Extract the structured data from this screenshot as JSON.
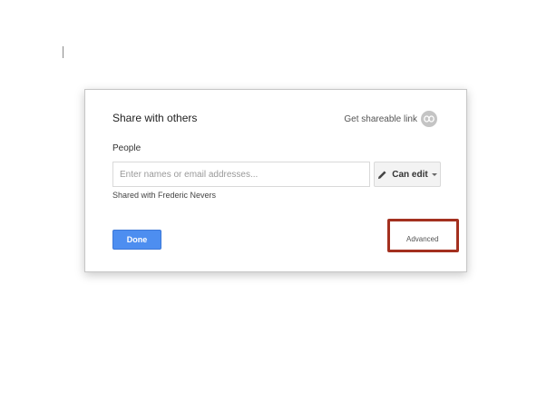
{
  "dialog": {
    "title": "Share with others",
    "get_link_label": "Get shareable link",
    "people_label": "People",
    "people_input": {
      "value": "",
      "placeholder": "Enter names or email addresses..."
    },
    "permission_label": "Can edit",
    "shared_with_text": "Shared with Frederic Nevers",
    "done_label": "Done",
    "advanced_label": "Advanced"
  },
  "colors": {
    "done_button": "#4d8ef0",
    "highlight": "#a3301f"
  },
  "icons": {
    "link": "link-icon",
    "permission": "pencil-icon",
    "dropdown": "chevron-down-icon"
  }
}
